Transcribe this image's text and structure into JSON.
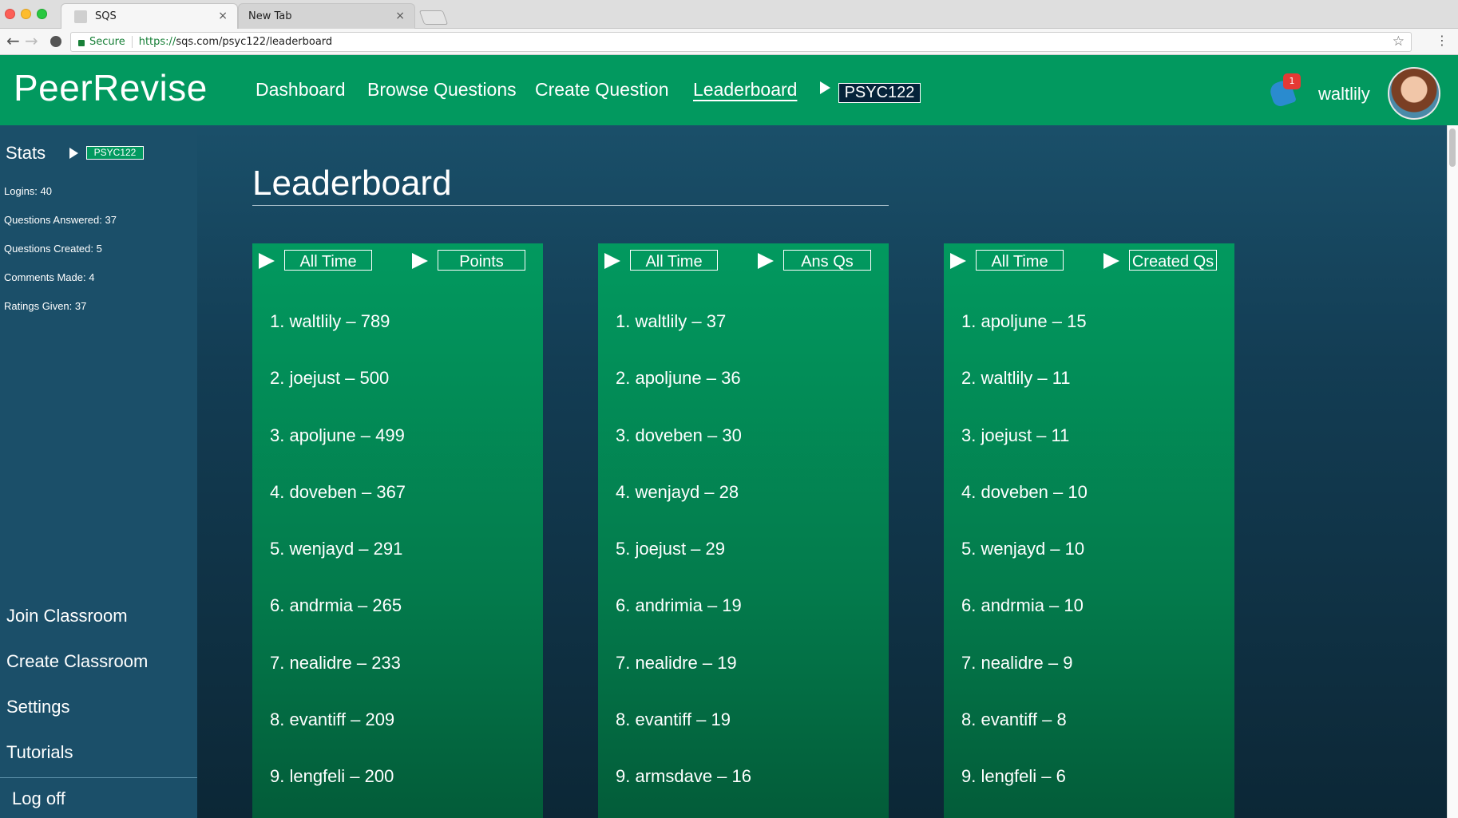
{
  "browser": {
    "tabs": [
      {
        "title": "SQS",
        "close": "×"
      },
      {
        "title": "New Tab",
        "close": "×"
      }
    ],
    "secure_label": "Secure",
    "url_scheme": "https://",
    "url_rest": "sqs.com/psyc122/leaderboard"
  },
  "app": {
    "logo": "PeerRevise",
    "nav": [
      "Dashboard",
      "Browse Questions",
      "Create Question",
      "Leaderboard"
    ],
    "course_tag": "PSYC122",
    "notification_count": "1",
    "username": "waltlily",
    "colors": {
      "accent_green": "#02995f",
      "sidebar": "#1b4f69",
      "badge": "#e53935"
    }
  },
  "sidebar": {
    "title": "Stats",
    "course_tag": "PSYC122",
    "stats": [
      "Logins: 40",
      "Questions Answered: 37",
      "Questions Created: 5",
      "Comments Made: 4",
      "Ratings Given: 37"
    ],
    "links": [
      "Join Classroom",
      "Create Classroom",
      "Settings",
      "Tutorials"
    ],
    "logoff": "Log off"
  },
  "main": {
    "title": "Leaderboard",
    "columns": [
      {
        "period": "All Time",
        "metric": "Points",
        "entries": [
          "1. waltlily – 789",
          "2. joejust – 500",
          "3. apoljune – 499",
          "4. doveben – 367",
          "5. wenjayd – 291",
          "6. andrmia – 265",
          "7. nealidre – 233",
          "8. evantiff – 209",
          "9. lengfeli – 200"
        ]
      },
      {
        "period": "All Time",
        "metric": "Ans Qs",
        "entries": [
          "1. waltlily – 37",
          "2. apoljune – 36",
          "3. doveben – 30",
          "4. wenjayd – 28",
          "5. joejust – 29",
          "6. andrimia – 19",
          "7. nealidre – 19",
          "8. evantiff – 19",
          "9. armsdave – 16"
        ]
      },
      {
        "period": "All Time",
        "metric": "Created Qs",
        "entries": [
          "1. apoljune – 15",
          "2. waltlily – 11",
          "3. joejust – 11",
          "4. doveben – 10",
          "5. wenjayd –  10",
          "6. andrmia – 10",
          "7. nealidre – 9",
          "8. evantiff – 8",
          "9. lengfeli – 6"
        ]
      }
    ]
  }
}
